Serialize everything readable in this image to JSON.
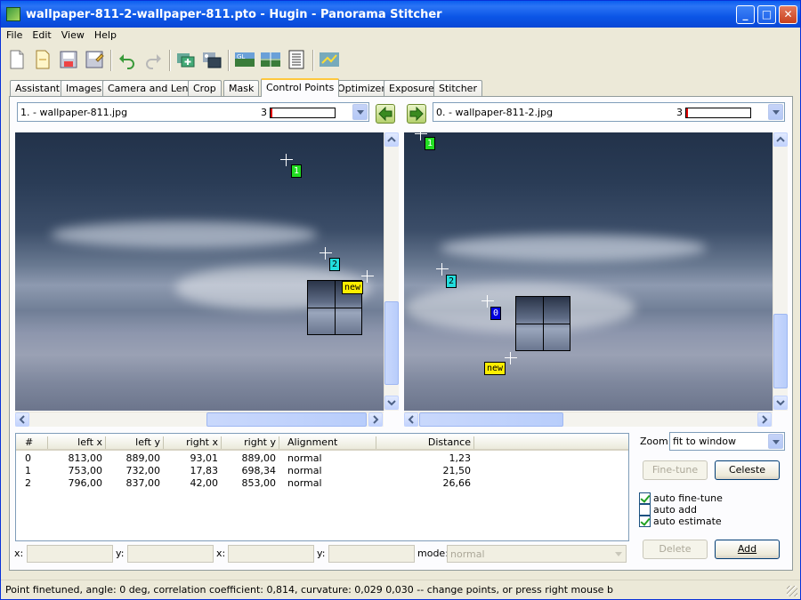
{
  "window": {
    "title": "wallpaper-811-2-wallpaper-811.pto - Hugin - Panorama Stitcher"
  },
  "menu": [
    "File",
    "Edit",
    "View",
    "Help"
  ],
  "toolbar": [
    "new-project-icon",
    "open-project-icon",
    "save-project-icon",
    "save-as-icon",
    "undo-icon",
    "redo-icon",
    "add-images-icon",
    "add-time-images-icon",
    "opengl-preview-icon",
    "preview-icon",
    "layout-list-icon",
    "optimize-icon"
  ],
  "tabs": [
    "Assistant",
    "Images",
    "Camera and Lens",
    "Crop",
    "Mask",
    "Control Points",
    "Optimizer",
    "Exposure",
    "Stitcher"
  ],
  "active_tab": "Control Points",
  "left": {
    "image": "1. - wallpaper-811.jpg",
    "count": "3",
    "quality": 0.03
  },
  "right": {
    "image": "0. - wallpaper-811-2.jpg",
    "count": "3",
    "quality": 0.03
  },
  "left_points": [
    "1",
    "2"
  ],
  "right_points": [
    "1",
    "2",
    "0"
  ],
  "new_label": "new",
  "table": {
    "headers": [
      "#",
      "left x",
      "left y",
      "right x",
      "right y",
      "Alignment",
      "Distance"
    ],
    "rows": [
      [
        "0",
        "813,00",
        "889,00",
        "93,01",
        "889,00",
        "normal",
        "1,23"
      ],
      [
        "1",
        "753,00",
        "732,00",
        "17,83",
        "698,34",
        "normal",
        "21,50"
      ],
      [
        "2",
        "796,00",
        "837,00",
        "42,00",
        "853,00",
        "normal",
        "26,66"
      ]
    ]
  },
  "coords": {
    "x": "x:",
    "y": "y:",
    "mode": "mode:",
    "mode_value": "normal"
  },
  "zoom": {
    "label": "Zoom:",
    "value": "fit to window"
  },
  "buttons": {
    "finetune": "Fine-tune",
    "celeste": "Celeste",
    "delete": "Delete",
    "add": "Add"
  },
  "options": {
    "auto_finetune": {
      "label": "auto fine-tune",
      "checked": true
    },
    "auto_add": {
      "label": "auto add",
      "checked": false
    },
    "auto_estimate": {
      "label": "auto estimate",
      "checked": true
    }
  },
  "status": "Point finetuned, angle: 0 deg, correlation coefficient: 0,814, curvature: 0,029 0,030  -- change points, or press right mouse b"
}
